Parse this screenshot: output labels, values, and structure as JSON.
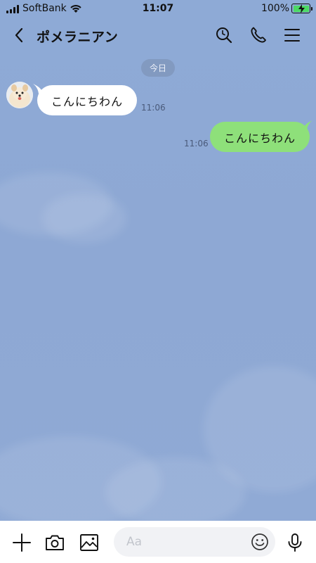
{
  "status": {
    "carrier": "SoftBank",
    "time": "11:07",
    "battery": "100%"
  },
  "header": {
    "title": "ポメラニアン",
    "icons": [
      "back-icon",
      "search-icon",
      "phone-icon",
      "menu-icon"
    ]
  },
  "chat": {
    "date_label": "今日",
    "messages": [
      {
        "direction": "incoming",
        "text": "こんにちわん",
        "time": "11:06"
      },
      {
        "direction": "outgoing",
        "text": "こんにちわん",
        "time": "11:06"
      }
    ]
  },
  "input": {
    "placeholder": "Aa",
    "icons": [
      "plus-icon",
      "camera-icon",
      "image-icon",
      "emoji-icon",
      "microphone-icon"
    ]
  },
  "colors": {
    "background": "#8fa9d4",
    "outgoing_bubble": "#8ee07a",
    "incoming_bubble": "#ffffff"
  }
}
